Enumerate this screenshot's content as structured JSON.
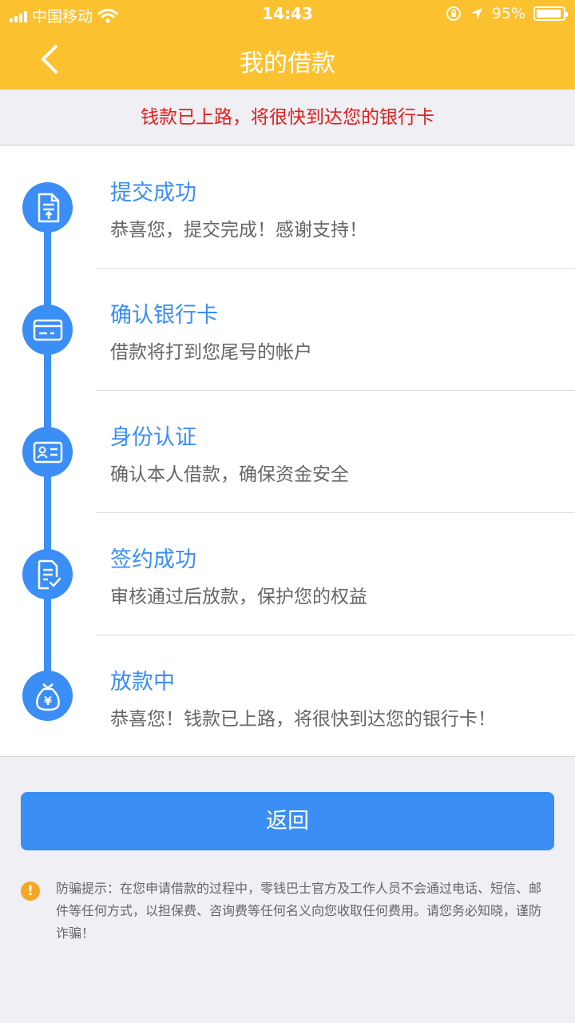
{
  "status_bar": {
    "carrier": "中国移动",
    "time": "14:43",
    "battery": "95%",
    "battery_level": 0.95,
    "icons": [
      "signal-icon",
      "wifi-icon",
      "orientation-lock-icon",
      "location-icon",
      "battery-icon"
    ]
  },
  "nav": {
    "title": "我的借款",
    "back_icon": "chevron-left-icon"
  },
  "banner": {
    "text": "钱款已上路，将很快到达您的银行卡"
  },
  "steps": [
    {
      "title": "提交成功",
      "desc": "恭喜您，提交完成！感谢支持！",
      "icon": "document-upload-icon"
    },
    {
      "title": "确认银行卡",
      "desc": "借款将打到您尾号的帐户",
      "icon": "bank-card-icon"
    },
    {
      "title": "身份认证",
      "desc": "确认本人借款，确保资金安全",
      "icon": "id-card-icon"
    },
    {
      "title": "签约成功",
      "desc": "审核通过后放款，保护您的权益",
      "icon": "contract-check-icon"
    },
    {
      "title": "放款中",
      "desc": "恭喜您！钱款已上路，将很快到达您的银行卡！",
      "icon": "money-bag-icon"
    }
  ],
  "return_button": {
    "label": "返回"
  },
  "warning": {
    "icon_glyph": "!",
    "text": "防骗提示：在您申请借款的过程中，零钱巴士官方及工作人员不会通过电话、短信、邮件等任何方式，以担保费、咨询费等任何名义向您收取任何费用。请您务必知晓，谨防诈骗！"
  },
  "colors": {
    "header": "#fbc12f",
    "accent": "#3a8ef5",
    "banner_text": "#e0201e",
    "warning": "#f5a623",
    "background": "#efeff4"
  }
}
